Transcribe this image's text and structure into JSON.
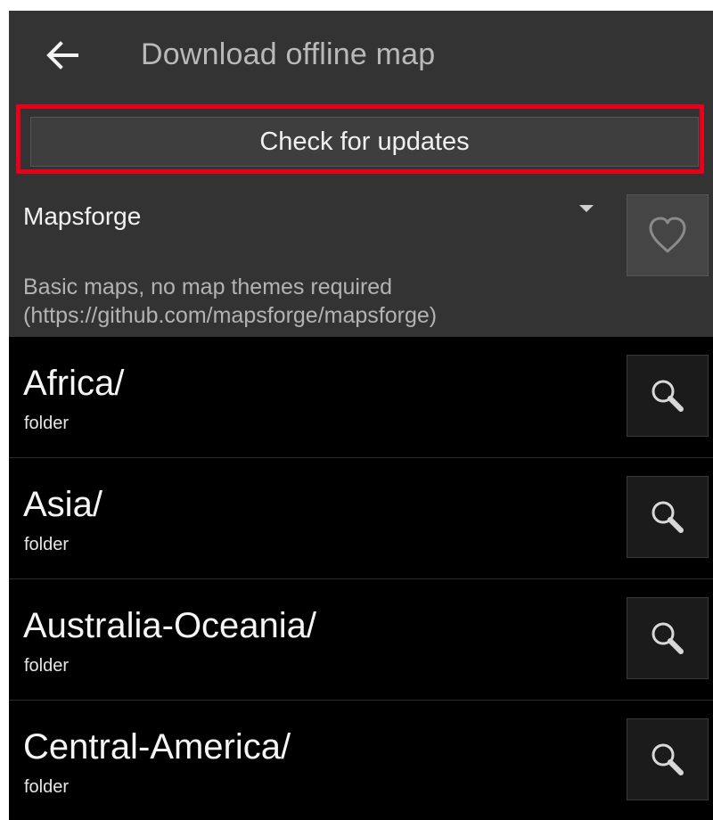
{
  "appbar": {
    "title": "Download offline map",
    "back_icon": "arrow-left-icon"
  },
  "header": {
    "check_updates_label": "Check for updates",
    "highlight_color": "#e8001a",
    "map_source": "Mapsforge",
    "dropdown_icon": "caret-down-icon",
    "favorite_icon": "heart-icon",
    "description_line1": "Basic maps, no map themes required",
    "description_line2": "(https://github.com/mapsforge/mapsforge)"
  },
  "list": {
    "items": [
      {
        "name": "Africa/",
        "type": "folder"
      },
      {
        "name": "Asia/",
        "type": "folder"
      },
      {
        "name": "Australia-Oceania/",
        "type": "folder"
      },
      {
        "name": "Central-America/",
        "type": "folder"
      }
    ],
    "item_icon": "magnifier-icon"
  },
  "colors": {
    "background": "#000000",
    "header_background": "#333333",
    "text_primary": "#f5f5f5",
    "text_secondary": "#b3b3b3"
  }
}
